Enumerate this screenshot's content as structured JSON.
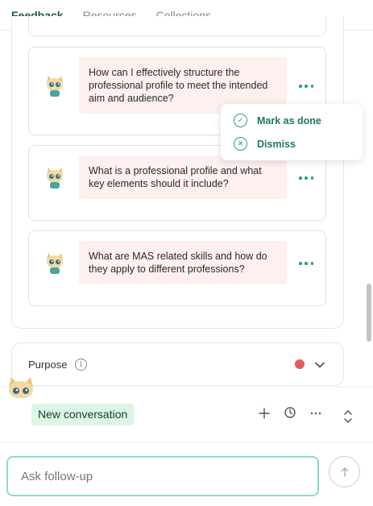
{
  "tabs": [
    {
      "label": "Feedback"
    },
    {
      "label": "Resources"
    },
    {
      "label": "Collections"
    }
  ],
  "questions": [
    {
      "text": "How can I effectively structure the professional profile to meet the intended aim and audience?"
    },
    {
      "text": "What is a professional profile and what key elements should it include?"
    },
    {
      "text": "What are MAS related skills and how do they apply to different professions?"
    }
  ],
  "menu": {
    "mark_done": "Mark as done",
    "dismiss": "Dismiss"
  },
  "purpose": {
    "label": "Purpose",
    "status_color": "#e25c5c"
  },
  "conversation": {
    "label": "New conversation"
  },
  "input": {
    "placeholder": "Ask follow-up"
  },
  "colors": {
    "accent": "#2f9a6f",
    "bubble": "#fdf0ee"
  }
}
